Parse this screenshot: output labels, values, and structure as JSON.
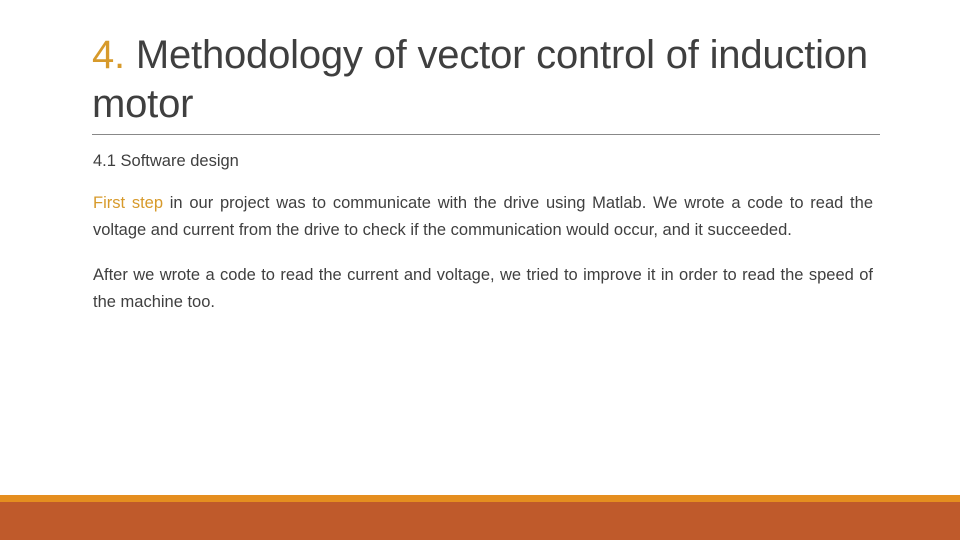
{
  "slide": {
    "title": {
      "number": "4.",
      "rest": " Methodology of vector control of induction motor",
      "full": "4. Methodology of vector control of induction motor"
    },
    "subheading": "4.1 Software design",
    "paragraphs": [
      {
        "lead": "First step",
        "text": " in our project was to communicate with the drive using Matlab. We wrote a code to read the voltage and current from the drive to check if the communication would occur, and it succeeded."
      },
      {
        "lead": "",
        "text": "After we wrote a code to read the current and voltage, we tried to improve it in order to read the speed of the machine too."
      }
    ]
  },
  "colors": {
    "accent_gold": "#d79a2b",
    "band_orange": "#e58e1f",
    "band_terracotta": "#bf5a2b",
    "text_dark": "#3f3f3f",
    "rule_gray": "#888888",
    "background": "#ffffff"
  }
}
